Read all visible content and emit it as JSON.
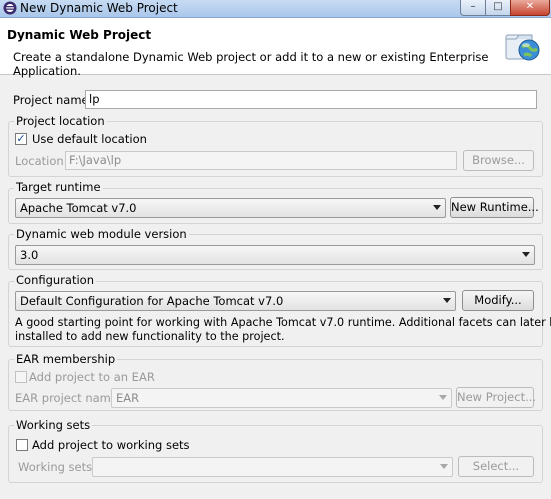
{
  "window": {
    "title": "New Dynamic Web Project"
  },
  "header": {
    "title": "Dynamic Web Project",
    "description": "Create a standalone Dynamic Web project or add it to a new or existing Enterprise Application."
  },
  "project_name": {
    "label": "Project name:",
    "value": "lp"
  },
  "project_location": {
    "group_label": "Project location",
    "use_default_label": "Use default location",
    "use_default_checked": true,
    "location_label": "Location:",
    "location_value": "F:\\Java\\lp",
    "browse_label": "Browse..."
  },
  "target_runtime": {
    "group_label": "Target runtime",
    "selected": "Apache Tomcat v7.0",
    "new_runtime_label": "New Runtime..."
  },
  "module_version": {
    "group_label": "Dynamic web module version",
    "selected": "3.0"
  },
  "configuration": {
    "group_label": "Configuration",
    "selected": "Default Configuration for Apache Tomcat v7.0",
    "modify_label": "Modify...",
    "description_line1": "A good starting point for working with Apache Tomcat v7.0 runtime. Additional facets can later be",
    "description_line2": "installed to add new functionality to the project."
  },
  "ear": {
    "group_label": "EAR membership",
    "add_label": "Add project to an EAR",
    "add_checked": false,
    "name_label": "EAR project name:",
    "name_value": "EAR",
    "new_project_label": "New Project..."
  },
  "working_sets": {
    "group_label": "Working sets",
    "add_label": "Add project to working sets",
    "add_checked": false,
    "sets_label": "Working sets:",
    "sets_value": "",
    "select_label": "Select..."
  },
  "icons": {
    "app": "eclipse-icon",
    "wizard": "web-project-globe-icon",
    "checkbox_checked": "checkmark-icon",
    "dropdown": "chevron-down-icon"
  },
  "colors": {
    "title_bar": "#a9c6ea",
    "close_button": "#c7452f",
    "header_bg": "#ffffff",
    "dialog_bg": "#f0f0f0"
  }
}
